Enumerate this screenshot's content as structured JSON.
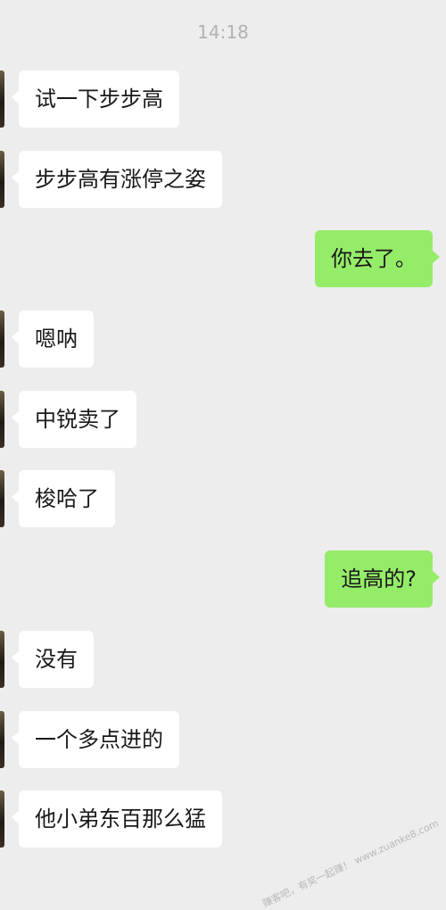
{
  "header": {
    "time": "14:18"
  },
  "messages": [
    {
      "dir": "in",
      "text": "试一下步步高"
    },
    {
      "dir": "in",
      "text": "步步高有涨停之姿"
    },
    {
      "dir": "out",
      "text": "你去了。"
    },
    {
      "dir": "in",
      "text": "嗯呐"
    },
    {
      "dir": "in",
      "text": "中锐卖了"
    },
    {
      "dir": "in",
      "text": "梭哈了"
    },
    {
      "dir": "out",
      "text": "追高的?"
    },
    {
      "dir": "in",
      "text": "没有"
    },
    {
      "dir": "in",
      "text": "一个多点进的"
    },
    {
      "dir": "in",
      "text": "他小弟东百那么猛"
    }
  ],
  "watermark": {
    "text": "赚客吧，有奖一起赚！ www.zuanke8.com"
  },
  "colors": {
    "background": "#ededed",
    "incoming_bubble": "#ffffff",
    "outgoing_bubble": "#95ec69",
    "timestamp": "#b2b2b2"
  }
}
